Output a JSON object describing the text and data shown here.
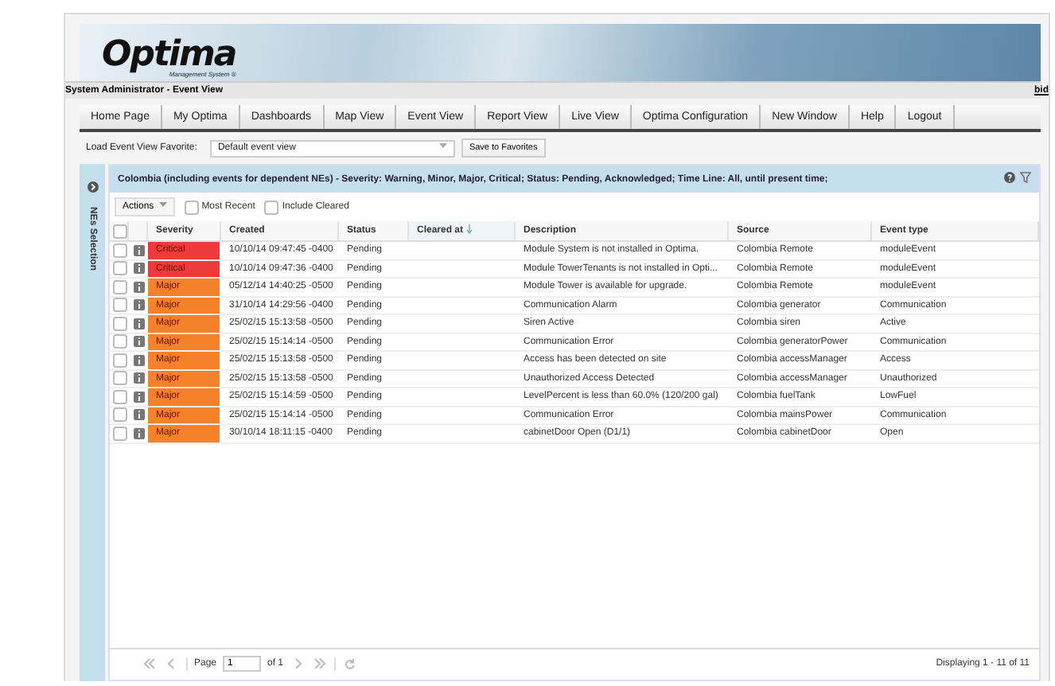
{
  "header": {
    "logo": "Optima",
    "logo_subtitle": "Management System ®",
    "user_bar": "System Administrator - Event View",
    "user_bar_right": "bid"
  },
  "nav": {
    "items": [
      "Home Page",
      "My Optima",
      "Dashboards",
      "Map View",
      "Event View",
      "Report View",
      "Live View",
      "Optima Configuration",
      "New Window",
      "Help",
      "Logout"
    ]
  },
  "favorite": {
    "label": "Load Event View Favorite:",
    "value": "Default event view",
    "button": "Save to Favorites"
  },
  "sidebar": {
    "title": "NEs Selection"
  },
  "panel": {
    "title": "Colombia (including events for dependent NEs) - Severity: Warning, Minor, Major, Critical; Status: Pending, Acknowledged; Time Line: All, until present time;"
  },
  "toolbar": {
    "actions": "Actions",
    "checkboxes": [
      {
        "label": "Most Recent",
        "checked": false
      },
      {
        "label": "Include Cleared",
        "checked": false
      }
    ]
  },
  "table": {
    "all_checked": false,
    "columns": [
      {
        "label": "Severity",
        "sorted": false
      },
      {
        "label": "Created",
        "sorted": false
      },
      {
        "label": "Status",
        "sorted": false
      },
      {
        "label": "Cleared at",
        "sorted": true
      },
      {
        "label": "Description",
        "sorted": false
      },
      {
        "label": "Source",
        "sorted": false
      },
      {
        "label": "Event type",
        "sorted": false
      }
    ],
    "rows": [
      {
        "checked": false,
        "severity": "Critical",
        "color": "#ee3a3a",
        "created": "10/10/14 09:47:45 -0400",
        "status": "Pending",
        "description": "Module System is not installed in Optima.",
        "source": "Colombia Remote",
        "event_type": "moduleEvent"
      },
      {
        "checked": false,
        "severity": "Critical",
        "color": "#ee3a3a",
        "created": "10/10/14 09:47:36 -0400",
        "status": "Pending",
        "description": "Module TowerTenants is not installed in Opti...",
        "source": "Colombia Remote",
        "event_type": "moduleEvent"
      },
      {
        "checked": false,
        "severity": "Major",
        "color": "#f5822a",
        "created": "05/12/14 14:40:25 -0500",
        "status": "Pending",
        "description": "Module Tower is available for upgrade.",
        "source": "Colombia Remote",
        "event_type": "moduleEvent"
      },
      {
        "checked": false,
        "severity": "Major",
        "color": "#f5822a",
        "created": "31/10/14 14:29:56 -0400",
        "status": "Pending",
        "description": "Communication Alarm",
        "source": "Colombia generator",
        "event_type": "Communication"
      },
      {
        "checked": false,
        "severity": "Major",
        "color": "#f5822a",
        "created": "25/02/15 15:13:58 -0500",
        "status": "Pending",
        "description": "Siren Active",
        "source": "Colombia siren",
        "event_type": "Active"
      },
      {
        "checked": false,
        "severity": "Major",
        "color": "#f5822a",
        "created": "25/02/15 15:14:14 -0500",
        "status": "Pending",
        "description": "Communication Error",
        "source": "Colombia generatorPower",
        "event_type": "Communication"
      },
      {
        "checked": false,
        "severity": "Major",
        "color": "#f5822a",
        "created": "25/02/15 15:13:58 -0500",
        "status": "Pending",
        "description": "Access has been detected on site",
        "source": "Colombia accessManager",
        "event_type": "Access"
      },
      {
        "checked": false,
        "severity": "Major",
        "color": "#f5822a",
        "created": "25/02/15 15:13:58 -0500",
        "status": "Pending",
        "description": "Unauthorized Access Detected",
        "source": "Colombia accessManager",
        "event_type": "Unauthorized"
      },
      {
        "checked": false,
        "severity": "Major",
        "color": "#f5822a",
        "created": "25/02/15 15:14:59 -0500",
        "status": "Pending",
        "description": "LevelPercent is less than 60.0% (120/200 gal)",
        "source": "Colombia fuelTank",
        "event_type": "LowFuel"
      },
      {
        "checked": false,
        "severity": "Major",
        "color": "#f5822a",
        "created": "25/02/15 15:14:14 -0500",
        "status": "Pending",
        "description": "Communication Error",
        "source": "Colombia mainsPower",
        "event_type": "Communication"
      },
      {
        "checked": false,
        "severity": "Major",
        "color": "#f5822a",
        "created": "30/10/14 18:11:15 -0400",
        "status": "Pending",
        "description": "cabinetDoor Open (D1/1)",
        "source": "Colombia cabinetDoor",
        "event_type": "Open"
      }
    ]
  },
  "pager": {
    "page_label": "Page",
    "page": "1",
    "of": "of 1",
    "summary": "Displaying 1 - 11 of 11"
  }
}
